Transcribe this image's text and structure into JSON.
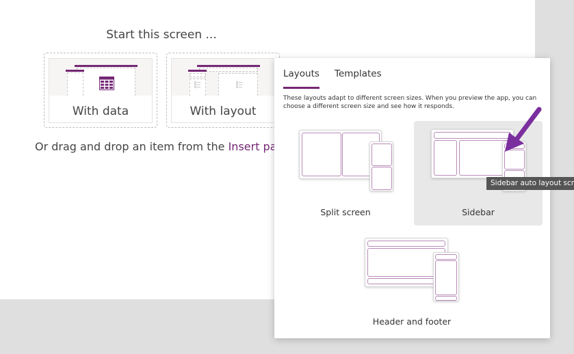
{
  "canvas": {
    "start_title": "Start this screen ...",
    "start_options": [
      {
        "label": "With data",
        "icon": "table-icon"
      },
      {
        "label": "With layout",
        "icon": "layout-icon"
      }
    ],
    "drag_text": "Or drag and drop an item from the ",
    "drag_link": "Insert pane"
  },
  "flyout": {
    "tabs": [
      {
        "label": "Layouts",
        "active": true
      },
      {
        "label": "Templates",
        "active": false
      }
    ],
    "description": "These layouts adapt to different screen sizes. When you preview the app, you can choose a different screen size and see how it responds.",
    "layouts": [
      {
        "label": "Split screen",
        "selected": false
      },
      {
        "label": "Sidebar",
        "selected": true
      },
      {
        "label": "Header and footer",
        "selected": false
      }
    ],
    "tooltip": "Sidebar auto layout screen"
  },
  "colors": {
    "accent": "#742774",
    "annotation_arrow": "#7b2f9e",
    "workspace_bg": "#dfdfdf",
    "selected_bg": "#e8e8e8",
    "tooltip_bg": "#555555"
  }
}
